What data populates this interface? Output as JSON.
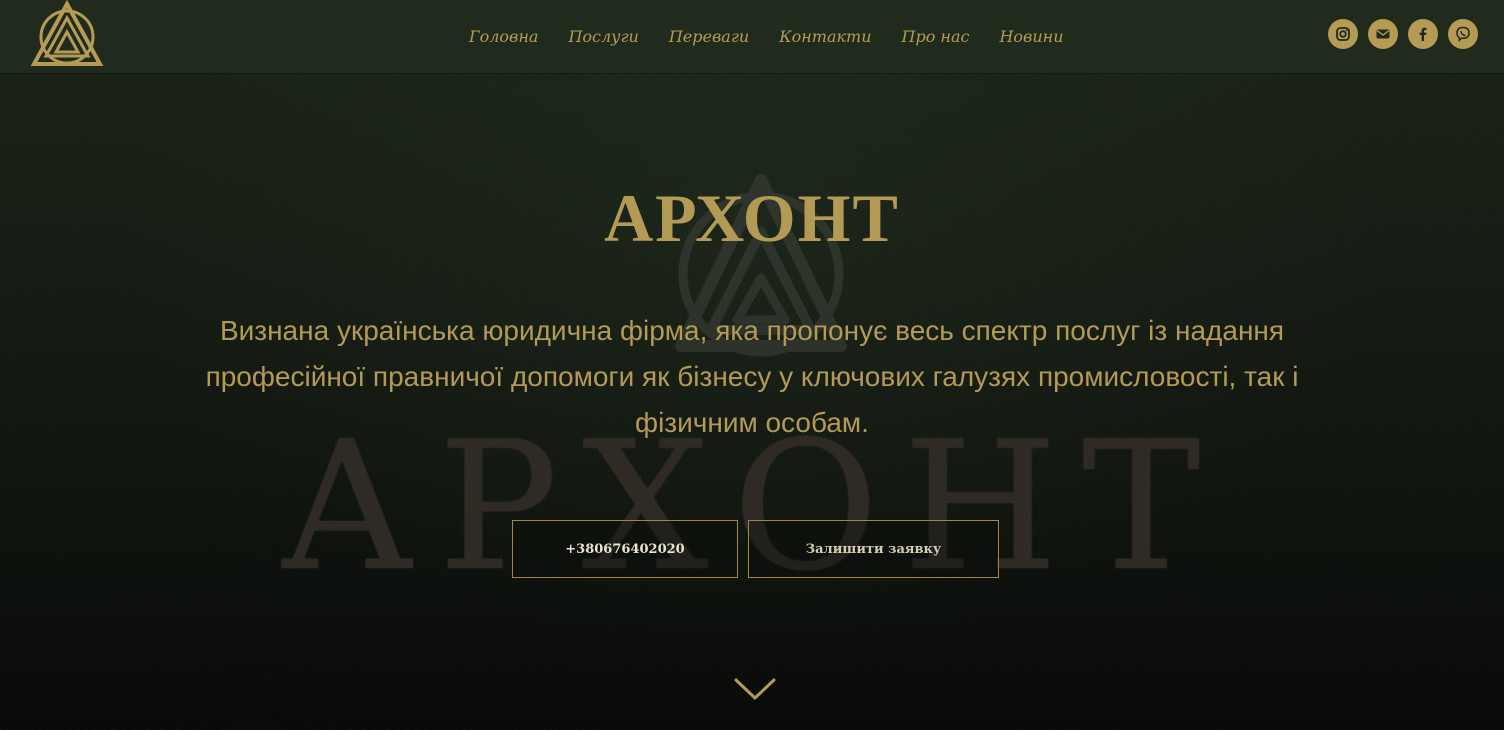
{
  "header": {
    "brand_logo": "archont-emblem-logo",
    "nav": [
      {
        "label": "Головна"
      },
      {
        "label": "Послуги"
      },
      {
        "label": "Переваги"
      },
      {
        "label": "Контакти"
      },
      {
        "label": "Про нас"
      },
      {
        "label": "Новини"
      }
    ],
    "socials": [
      {
        "icon": "instagram-icon"
      },
      {
        "icon": "mail-icon"
      },
      {
        "icon": "facebook-icon"
      },
      {
        "icon": "viber-icon"
      }
    ]
  },
  "hero": {
    "title": "АРХОНТ",
    "description": "Визнана українська юридична фірма, яка пропонує весь спектр послуг із надання професійної правничої допомоги як бізнесу у ключових галузях промисловості, так і фізичним особам.",
    "watermark_text": "АРХОНТ",
    "phone_button": "+380676402020",
    "request_button": "Залишити заявку",
    "scroll_icon": "chevron-down-icon"
  },
  "colors": {
    "accent_gold": "#b69b55",
    "header_bg": "#202b1d",
    "hero_bg": "#161d14"
  }
}
